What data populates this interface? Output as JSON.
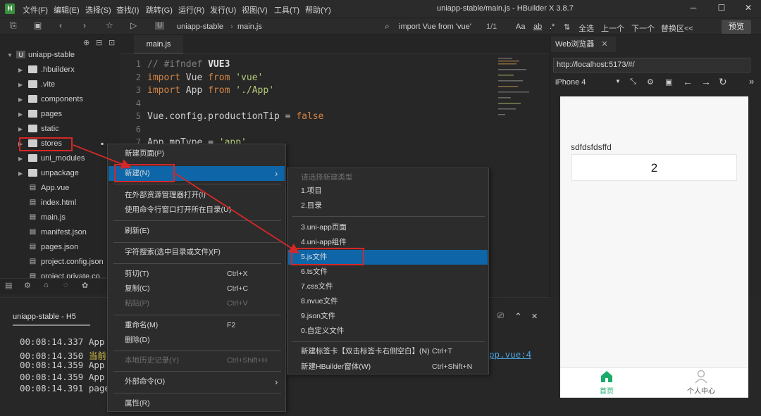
{
  "titlebar": {
    "menu": [
      "文件(F)",
      "编辑(E)",
      "选择(S)",
      "查找(I)",
      "跳转(G)",
      "运行(R)",
      "发行(U)",
      "视图(V)",
      "工具(T)",
      "帮助(Y)"
    ],
    "title": "uniapp-stable/main.js - HBuilder X 3.8.7"
  },
  "toolbar": {
    "project": "uniapp-stable",
    "file": "main.js",
    "search": "import Vue from 'vue'",
    "match": "1/1",
    "opt_aa": "Aa",
    "opt_word": "ab",
    "opt_regex": ".*",
    "select_all": "全选",
    "prev": "上一个",
    "next": "下一个",
    "replace": "替换区<<",
    "preview": "预览"
  },
  "sidebar": {
    "root": "uniapp-stable",
    "items": [
      {
        "label": ".hbuilderx",
        "type": "folder"
      },
      {
        "label": ".vite",
        "type": "folder"
      },
      {
        "label": "components",
        "type": "folder"
      },
      {
        "label": "pages",
        "type": "folder"
      },
      {
        "label": "static",
        "type": "folder"
      },
      {
        "label": "stores",
        "type": "folder"
      },
      {
        "label": "uni_modules",
        "type": "folder"
      },
      {
        "label": "unpackage",
        "type": "folder"
      },
      {
        "label": "App.vue",
        "type": "file"
      },
      {
        "label": "index.html",
        "type": "file"
      },
      {
        "label": "main.js",
        "type": "file"
      },
      {
        "label": "manifest.json",
        "type": "file"
      },
      {
        "label": "pages.json",
        "type": "file"
      },
      {
        "label": "project.config.json",
        "type": "file"
      },
      {
        "label": "project.private.co...",
        "type": "file"
      }
    ]
  },
  "editor": {
    "tab": "main.js",
    "lines": [
      "// #ifndef VUE3",
      "import Vue from 'vue'",
      "import App from './App'",
      "",
      "Vue.config.productionTip = false",
      "",
      "App.mpType = 'app'"
    ]
  },
  "browser": {
    "tab": "Web浏览器",
    "url": "http://localhost:5173/#/",
    "device": "iPhone 4",
    "text": "sdfdsfdsffd",
    "count": "2",
    "tab_home": "首页",
    "tab_user": "个人中心"
  },
  "console": {
    "tab": "uniapp-stable - H5",
    "lines": [
      "00:08:14.337 App",
      "00:08:14.350 当前",
      "00:08:14.359 App",
      "00:08:14.359 App",
      "00:08:14.391 page"
    ],
    "link": "pp.vue:4"
  },
  "context_menu": {
    "items": [
      {
        "label": "新建页面(P)"
      },
      {
        "label": "新建(N)"
      },
      {
        "label": "在外部资源管理器打开(I)"
      },
      {
        "label": "使用命令行窗口打开所在目录(U)"
      },
      {
        "label": "刷新(E)"
      },
      {
        "label": "字符搜索(选中目录或文件)(F)"
      },
      {
        "label": "剪切(T)",
        "shortcut": "Ctrl+X"
      },
      {
        "label": "复制(C)",
        "shortcut": "Ctrl+C"
      },
      {
        "label": "粘贴(P)",
        "shortcut": "Ctrl+V"
      },
      {
        "label": "重命名(M)",
        "shortcut": "F2"
      },
      {
        "label": "删除(D)"
      },
      {
        "label": "本地历史记录(Y)",
        "shortcut": "Ctrl+Shift+H"
      },
      {
        "label": "外部命令(O)"
      },
      {
        "label": "属性(R)"
      }
    ]
  },
  "submenu": {
    "header": "请选择新建类型",
    "items": [
      {
        "label": "1.项目"
      },
      {
        "label": "2.目录"
      },
      {
        "label": "3.uni-app页面"
      },
      {
        "label": "4.uni-app组件"
      },
      {
        "label": "5.js文件"
      },
      {
        "label": "6.ts文件"
      },
      {
        "label": "7.css文件"
      },
      {
        "label": "8.nvue文件"
      },
      {
        "label": "9.json文件"
      },
      {
        "label": "0.自定义文件"
      },
      {
        "label": "新建标签卡【双击标签卡右侧空白】(N)",
        "shortcut": "Ctrl+T"
      },
      {
        "label": "新建HBuilder窗体(W)",
        "shortcut": "Ctrl+Shift+N"
      }
    ]
  },
  "colors": {
    "accent": "#0e66a8",
    "annotation": "#d32828"
  }
}
